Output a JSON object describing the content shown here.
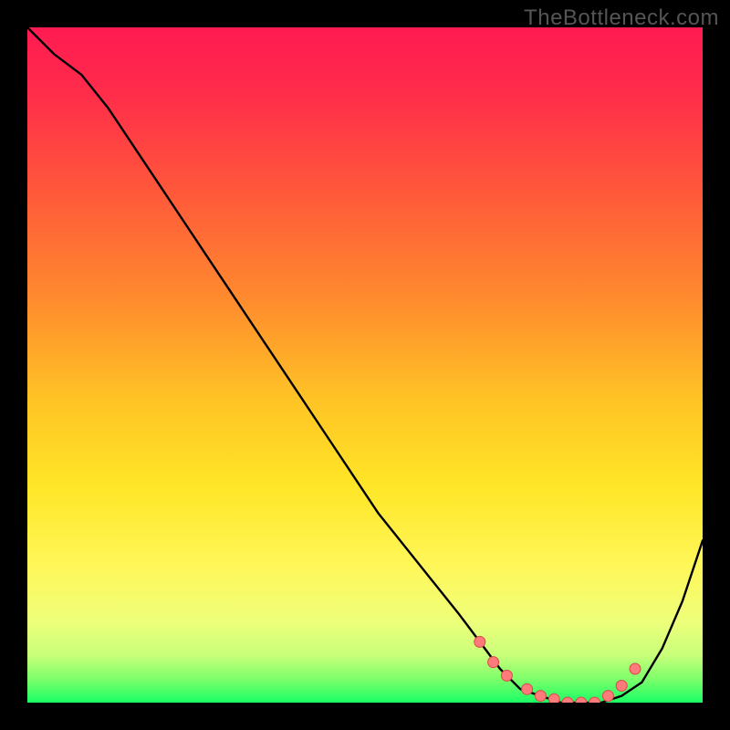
{
  "watermark": "TheBottleneck.com",
  "colors": {
    "curve": "#000000",
    "marker_fill": "#ff7a7a",
    "marker_stroke": "#d94a4a"
  },
  "chart_data": {
    "type": "line",
    "title": "",
    "xlabel": "",
    "ylabel": "",
    "xlim": [
      0,
      100
    ],
    "ylim": [
      0,
      100
    ],
    "x": [
      0,
      4,
      8,
      12,
      16,
      20,
      24,
      28,
      32,
      36,
      40,
      44,
      48,
      52,
      56,
      60,
      64,
      67,
      70,
      73,
      76,
      79,
      82,
      85,
      88,
      91,
      94,
      97,
      100
    ],
    "y": [
      100,
      96,
      93,
      88,
      82,
      76,
      70,
      64,
      58,
      52,
      46,
      40,
      34,
      28,
      23,
      18,
      13,
      9,
      5,
      2,
      1,
      0,
      0,
      0,
      1,
      3,
      8,
      15,
      24
    ],
    "markers_x": [
      67,
      69,
      71,
      74,
      76,
      78,
      80,
      82,
      84,
      86,
      88,
      90
    ],
    "markers_y": [
      9,
      6,
      4,
      2,
      1,
      0.5,
      0,
      0,
      0,
      1,
      2.5,
      5
    ]
  }
}
